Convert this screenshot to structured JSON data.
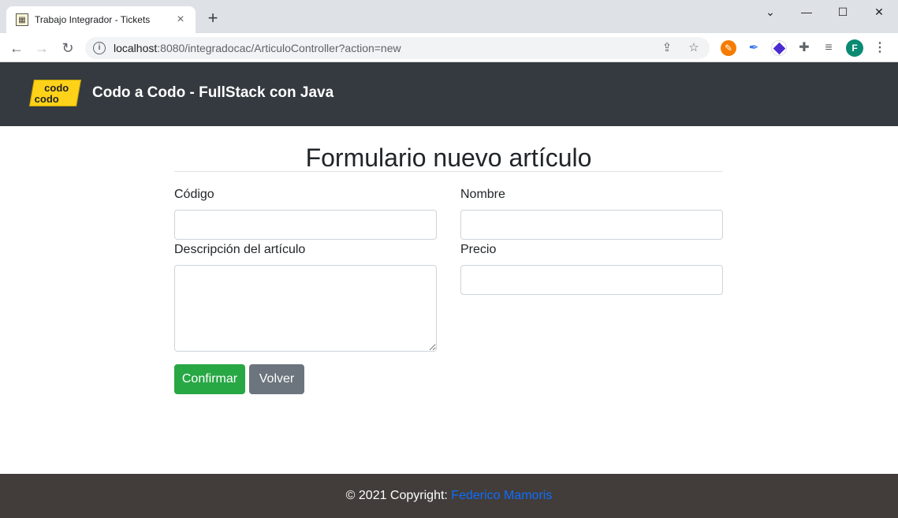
{
  "browser": {
    "tab_title": "Trabajo Integrador - Tickets",
    "tab_close": "×",
    "new_tab": "+",
    "url_host": "localhost",
    "url_rest": ":8080/integradocac/ArticuloController?action=new",
    "profile_initial": "F"
  },
  "navbar": {
    "logo_line1": "codo",
    "logo_line2": "codo",
    "brand": "Codo a Codo - FullStack con Java"
  },
  "form": {
    "title": "Formulario nuevo artículo",
    "codigo_label": "Código",
    "codigo_value": "",
    "nombre_label": "Nombre",
    "nombre_value": "",
    "descripcion_label": "Descripción del artículo",
    "descripcion_value": "",
    "precio_label": "Precio",
    "precio_value": "",
    "confirm_label": "Confirmar",
    "back_label": "Volver"
  },
  "footer": {
    "copyright": "© 2021 Copyright: ",
    "author": "Federico Mamoris"
  },
  "colors": {
    "navbar_bg": "#343a40",
    "footer_bg": "#423d3a",
    "success": "#28a745",
    "secondary": "#6c757d",
    "link": "#0d6efd"
  }
}
